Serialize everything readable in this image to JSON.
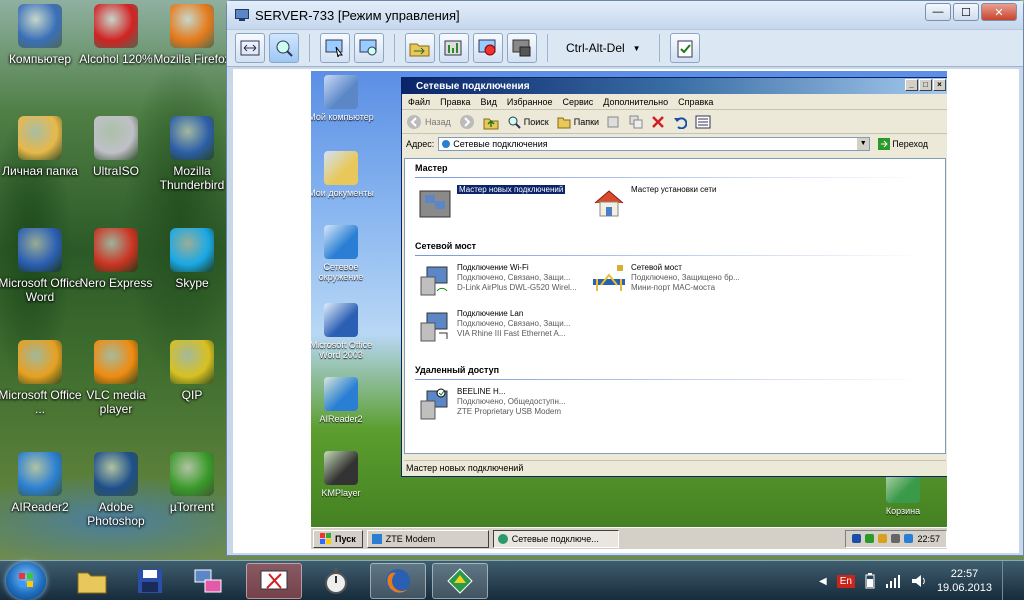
{
  "desktop_icons": [
    {
      "label": "Компьютер",
      "icon": "computer-icon",
      "color": "#3a6fb8"
    },
    {
      "label": "Alcohol 120%",
      "icon": "alcohol-icon",
      "color": "#d12222"
    },
    {
      "label": "Mozilla Firefox",
      "icon": "firefox-icon",
      "color": "#e57a1a"
    },
    {
      "label": "Личная папка",
      "icon": "folder-icon",
      "color": "#e8b84a"
    },
    {
      "label": "UltraISO",
      "icon": "disc-icon",
      "color": "#c0c0c8"
    },
    {
      "label": "Mozilla Thunderbird",
      "icon": "thunderbird-icon",
      "color": "#2d5fa8"
    },
    {
      "label": "Microsoft Office Word",
      "icon": "word-icon",
      "color": "#2b5fb4"
    },
    {
      "label": "Nero Express",
      "icon": "nero-icon",
      "color": "#cc3322"
    },
    {
      "label": "Skype",
      "icon": "skype-icon",
      "color": "#19a8e6"
    },
    {
      "label": "Microsoft Office ...",
      "icon": "outlook-icon",
      "color": "#e8a020"
    },
    {
      "label": "VLC media player",
      "icon": "vlc-icon",
      "color": "#f08a10"
    },
    {
      "label": "QIP",
      "icon": "qip-icon",
      "color": "#d8c020"
    },
    {
      "label": "AIReader2",
      "icon": "aireader-icon",
      "color": "#2a7fd4"
    },
    {
      "label": "Adobe Photoshop",
      "icon": "photoshop-icon",
      "color": "#1d4f8a"
    },
    {
      "label": "µTorrent",
      "icon": "utorrent-icon",
      "color": "#3a9a2a"
    }
  ],
  "remote_window": {
    "title": "SERVER-733 [Режим управления]",
    "minimize": "—",
    "maximize": "☐",
    "close": "✕",
    "cad_label": "Ctrl-Alt-Del"
  },
  "xp_desktop_icons": [
    {
      "label": "Мой компьютер",
      "icon": "my-computer-icon"
    },
    {
      "label": "Мои документы",
      "icon": "my-documents-icon"
    },
    {
      "label": "Сетевое окружение",
      "icon": "network-places-icon"
    },
    {
      "label": "Microsoft Office Word 2003",
      "icon": "word2003-icon"
    },
    {
      "label": "AIReader2",
      "icon": "aireader-icon"
    },
    {
      "label": "KMPlayer",
      "icon": "kmplayer-icon"
    },
    {
      "label": "Корзина",
      "icon": "recycle-bin-icon"
    }
  ],
  "network_window": {
    "title": "Сетевые подключения",
    "menu": [
      "Файл",
      "Правка",
      "Вид",
      "Избранное",
      "Сервис",
      "Дополнительно",
      "Справка"
    ],
    "back": "Назад",
    "search": "Поиск",
    "folders": "Папки",
    "address_label": "Адрес:",
    "address_value": "Сетевые подключения",
    "go": "Переход",
    "groups": {
      "wizard": "Мастер",
      "bridge": "Сетевой мост",
      "remote": "Удаленный доступ"
    },
    "items": {
      "new_conn": {
        "title": "Мастер новых подключений"
      },
      "net_setup": {
        "title": "Мастер установки сети"
      },
      "wifi": {
        "title": "Подключение Wi-Fi",
        "status": "Подключено, Связано, Защи...",
        "device": "D-Link AirPlus DWL-G520 Wirel..."
      },
      "bridge": {
        "title": "Сетевой мост",
        "status": "Подключено, Защищено бр...",
        "device": "Мини-порт MAC-моста"
      },
      "lan": {
        "title": "Подключение Lan",
        "status": "Подключено, Связано, Защи...",
        "device": "VIA Rhine III Fast Ethernet A..."
      },
      "beeline": {
        "title": "BEELINE H...",
        "status": "Подключено, Общедоступн...",
        "device": "ZTE Proprietary USB Modem"
      }
    },
    "status_bar": "Мастер новых подключений"
  },
  "xp_taskbar": {
    "start": "Пуск",
    "tasks": [
      "ZTE Modem",
      "Сетевые подключе..."
    ],
    "clock": "22:57"
  },
  "host_taskbar": {
    "lang": "En",
    "time": "22:57",
    "date": "19.06.2013"
  }
}
